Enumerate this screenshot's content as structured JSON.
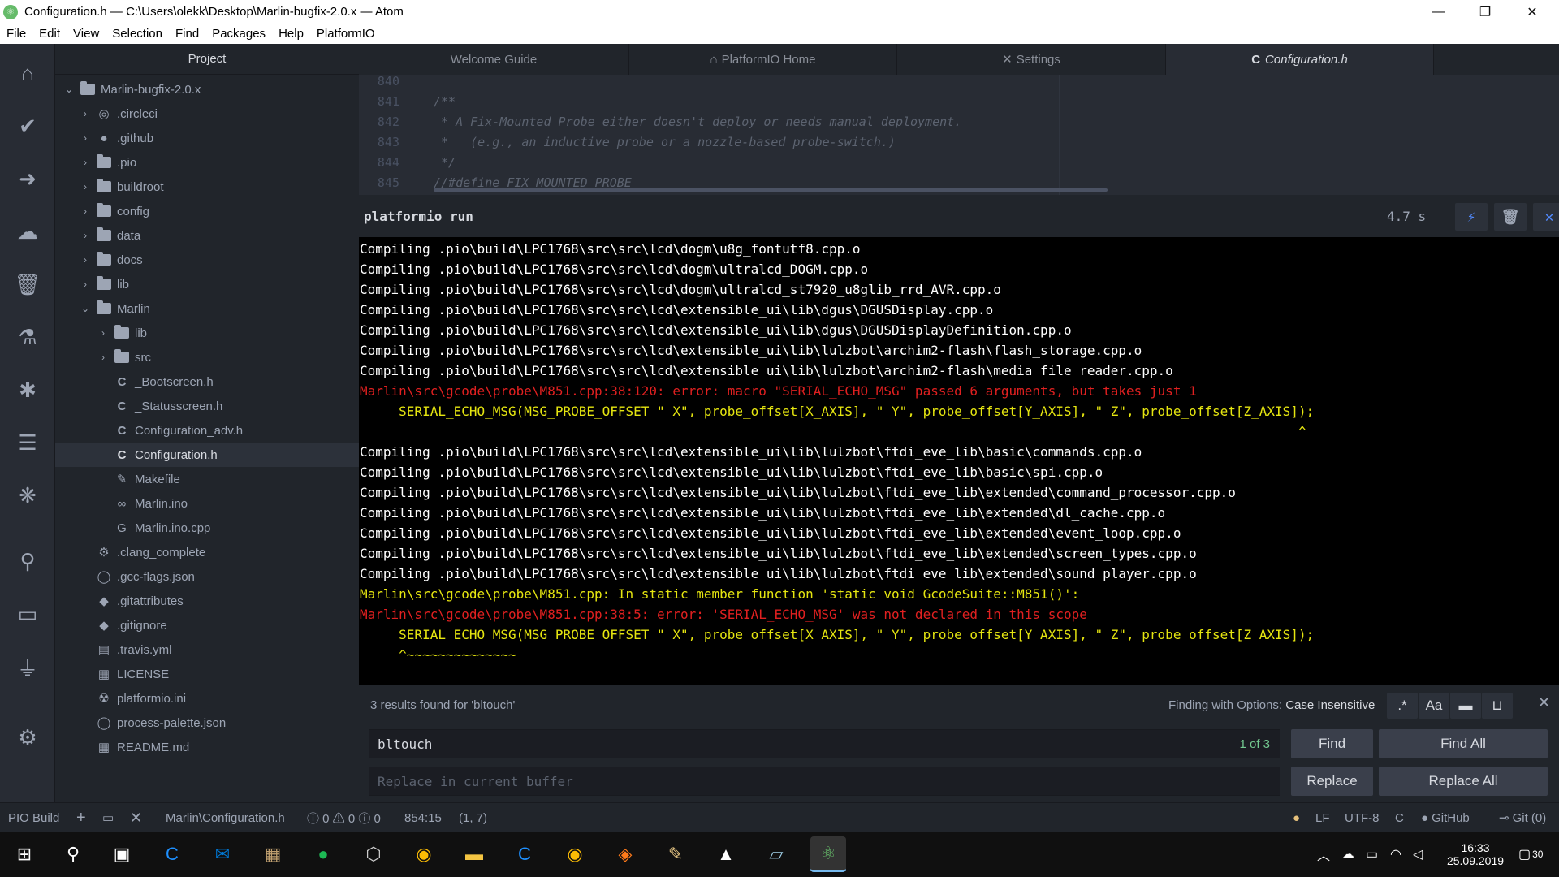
{
  "window": {
    "title": "Configuration.h — C:\\Users\\olekk\\Desktop\\Marlin-bugfix-2.0.x — Atom",
    "minimize": "—",
    "maximize": "❐",
    "close": "✕"
  },
  "menu": [
    "File",
    "Edit",
    "View",
    "Selection",
    "Find",
    "Packages",
    "Help",
    "PlatformIO"
  ],
  "project": {
    "header": "Project",
    "root": "Marlin-bugfix-2.0.x",
    "items": [
      {
        "label": ".circleci"
      },
      {
        "label": ".github"
      },
      {
        "label": ".pio"
      },
      {
        "label": "buildroot"
      },
      {
        "label": "config"
      },
      {
        "label": "data"
      },
      {
        "label": "docs"
      },
      {
        "label": "lib"
      },
      {
        "label": "Marlin"
      },
      {
        "label": "lib"
      },
      {
        "label": "src"
      },
      {
        "label": "_Bootscreen.h"
      },
      {
        "label": "_Statusscreen.h"
      },
      {
        "label": "Configuration_adv.h"
      },
      {
        "label": "Configuration.h"
      },
      {
        "label": "Makefile"
      },
      {
        "label": "Marlin.ino"
      },
      {
        "label": "Marlin.ino.cpp"
      },
      {
        "label": ".clang_complete"
      },
      {
        "label": ".gcc-flags.json"
      },
      {
        "label": ".gitattributes"
      },
      {
        "label": ".gitignore"
      },
      {
        "label": ".travis.yml"
      },
      {
        "label": "LICENSE"
      },
      {
        "label": "platformio.ini"
      },
      {
        "label": "process-palette.json"
      },
      {
        "label": "README.md"
      }
    ]
  },
  "tabs": [
    {
      "label": "Welcome Guide"
    },
    {
      "label": "PlatformIO Home"
    },
    {
      "label": "Settings"
    },
    {
      "label": "Configuration.h"
    }
  ],
  "editor": {
    "line_numbers": [
      "840",
      "841",
      "842",
      "843",
      "844",
      "845"
    ],
    "lines": [
      "",
      "/**",
      " * A Fix-Mounted Probe either doesn't deploy or needs manual deployment.",
      " *   (e.g., an inductive probe or a nozzle-based probe-switch.)",
      " */",
      "//#define FIX_MOUNTED_PROBE"
    ]
  },
  "terminal": {
    "title": "platformio run",
    "elapsed": "4.7 s",
    "lines": [
      {
        "t": "Compiling .pio\\build\\LPC1768\\src\\src\\lcd\\dogm\\u8g_fontutf8.cpp.o",
        "c": "w"
      },
      {
        "t": "Compiling .pio\\build\\LPC1768\\src\\src\\lcd\\dogm\\ultralcd_DOGM.cpp.o",
        "c": "w"
      },
      {
        "t": "Compiling .pio\\build\\LPC1768\\src\\src\\lcd\\dogm\\ultralcd_st7920_u8glib_rrd_AVR.cpp.o",
        "c": "w"
      },
      {
        "t": "Compiling .pio\\build\\LPC1768\\src\\src\\lcd\\extensible_ui\\lib\\dgus\\DGUSDisplay.cpp.o",
        "c": "w"
      },
      {
        "t": "Compiling .pio\\build\\LPC1768\\src\\src\\lcd\\extensible_ui\\lib\\dgus\\DGUSDisplayDefinition.cpp.o",
        "c": "w"
      },
      {
        "t": "Compiling .pio\\build\\LPC1768\\src\\src\\lcd\\extensible_ui\\lib\\lulzbot\\archim2-flash\\flash_storage.cpp.o",
        "c": "w"
      },
      {
        "t": "Compiling .pio\\build\\LPC1768\\src\\src\\lcd\\extensible_ui\\lib\\lulzbot\\archim2-flash\\media_file_reader.cpp.o",
        "c": "w"
      },
      {
        "t": "Marlin\\src\\gcode\\probe\\M851.cpp:38:120: error: macro \"SERIAL_ECHO_MSG\" passed 6 arguments, but takes just 1",
        "c": "r"
      },
      {
        "t": "     SERIAL_ECHO_MSG(MSG_PROBE_OFFSET \" X\", probe_offset[X_AXIS], \" Y\", probe_offset[Y_AXIS], \" Z\", probe_offset[Z_AXIS]);",
        "c": "y"
      },
      {
        "t": "                                                                                                                        ^",
        "c": "y"
      },
      {
        "t": "Compiling .pio\\build\\LPC1768\\src\\src\\lcd\\extensible_ui\\lib\\lulzbot\\ftdi_eve_lib\\basic\\commands.cpp.o",
        "c": "w"
      },
      {
        "t": "Compiling .pio\\build\\LPC1768\\src\\src\\lcd\\extensible_ui\\lib\\lulzbot\\ftdi_eve_lib\\basic\\spi.cpp.o",
        "c": "w"
      },
      {
        "t": "Compiling .pio\\build\\LPC1768\\src\\src\\lcd\\extensible_ui\\lib\\lulzbot\\ftdi_eve_lib\\extended\\command_processor.cpp.o",
        "c": "w"
      },
      {
        "t": "Compiling .pio\\build\\LPC1768\\src\\src\\lcd\\extensible_ui\\lib\\lulzbot\\ftdi_eve_lib\\extended\\dl_cache.cpp.o",
        "c": "w"
      },
      {
        "t": "Compiling .pio\\build\\LPC1768\\src\\src\\lcd\\extensible_ui\\lib\\lulzbot\\ftdi_eve_lib\\extended\\event_loop.cpp.o",
        "c": "w"
      },
      {
        "t": "Compiling .pio\\build\\LPC1768\\src\\src\\lcd\\extensible_ui\\lib\\lulzbot\\ftdi_eve_lib\\extended\\screen_types.cpp.o",
        "c": "w"
      },
      {
        "t": "Compiling .pio\\build\\LPC1768\\src\\src\\lcd\\extensible_ui\\lib\\lulzbot\\ftdi_eve_lib\\extended\\sound_player.cpp.o",
        "c": "w"
      },
      {
        "t": "Marlin\\src\\gcode\\probe\\M851.cpp: In static member function 'static void GcodeSuite::M851()':",
        "c": "y"
      },
      {
        "t": "Marlin\\src\\gcode\\probe\\M851.cpp:38:5: error: 'SERIAL_ECHO_MSG' was not declared in this scope",
        "c": "r"
      },
      {
        "t": "     SERIAL_ECHO_MSG(MSG_PROBE_OFFSET \" X\", probe_offset[X_AXIS], \" Y\", probe_offset[Y_AXIS], \" Z\", probe_offset[Z_AXIS]);",
        "c": "y"
      },
      {
        "t": "     ^~~~~~~~~~~~~~~",
        "c": "y"
      }
    ]
  },
  "find": {
    "results": "3 results found for 'bltouch'",
    "options_label": "Finding with Options:",
    "options_value": "Case Insensitive",
    "query": "bltouch",
    "count": "1 of 3",
    "replace_placeholder": "Replace in current buffer",
    "find_btn": "Find",
    "find_all_btn": "Find All",
    "replace_btn": "Replace",
    "replace_all_btn": "Replace All",
    "regex_opt": ".*",
    "case_opt": "Aa"
  },
  "status": {
    "pio_build": "PIO Build",
    "file": "Marlin\\Configuration.h",
    "problems": "ⓘ 0 ⚠ 0 ⓘ 0",
    "cursor": "854:15",
    "selection": "(1, 7)",
    "line_ending": "LF",
    "encoding": "UTF-8",
    "grammar": "C",
    "github": "GitHub",
    "git": "Git (0)"
  },
  "taskbar": {
    "time": "16:33",
    "date": "25.09.2019",
    "notif_count": "30"
  },
  "colors": {
    "accent": "#528bff",
    "error": "#e02020",
    "warning": "#e5e510"
  }
}
